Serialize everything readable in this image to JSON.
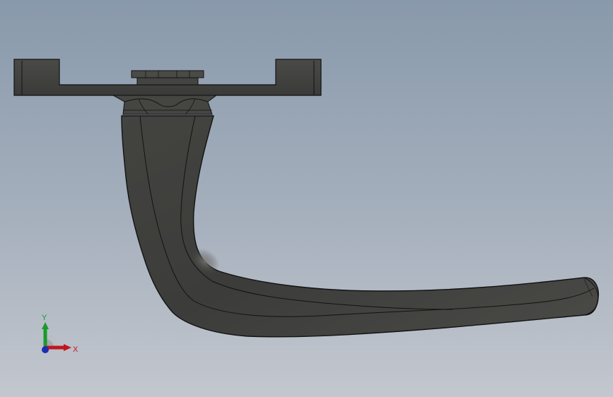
{
  "triad": {
    "y_label": "Y",
    "x_label": "X",
    "y_color": "#1a9a2a",
    "x_color": "#c0161c",
    "z_color": "#1a2fb0"
  },
  "model": {
    "part_color": "#3f3f3d",
    "edge_color": "#121212",
    "background_top": "#8899ab",
    "background_bottom": "#c3c7ce"
  }
}
